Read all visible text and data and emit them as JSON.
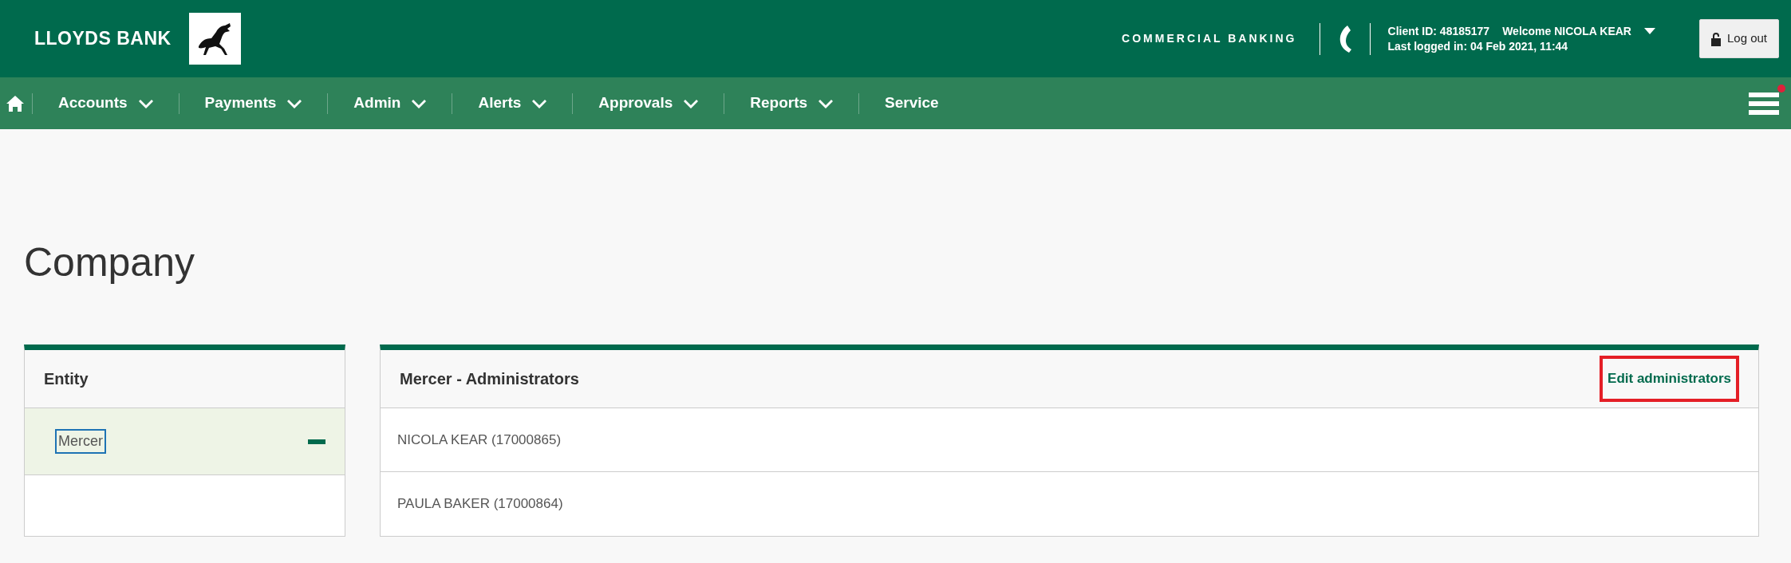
{
  "header": {
    "brand": "LLOYDS BANK",
    "division": "COMMERCIAL BANKING",
    "client_id": "Client ID: 48185177",
    "welcome": "Welcome NICOLA KEAR",
    "last_logged_in": "Last logged in: 04 Feb 2021, 11:44",
    "logout": "Log out"
  },
  "nav": {
    "items": [
      {
        "label": "Accounts",
        "dropdown": true
      },
      {
        "label": "Payments",
        "dropdown": true
      },
      {
        "label": "Admin",
        "dropdown": true
      },
      {
        "label": "Alerts",
        "dropdown": true
      },
      {
        "label": "Approvals",
        "dropdown": true
      },
      {
        "label": "Reports",
        "dropdown": true
      },
      {
        "label": "Service",
        "dropdown": false
      }
    ],
    "menu_notification": true
  },
  "page_title": "Company",
  "entity_panel": {
    "title": "Entity",
    "items": [
      {
        "label": "Mercer",
        "selected": true,
        "expanded": true,
        "focused": true
      }
    ]
  },
  "admin_panel": {
    "title": "Mercer - Administrators",
    "edit_link": {
      "label": "Edit administrators",
      "highlighted": true
    },
    "rows": [
      {
        "label": "NICOLA KEAR (17000865)"
      },
      {
        "label": "PAULA BAKER (17000864)"
      }
    ]
  }
}
